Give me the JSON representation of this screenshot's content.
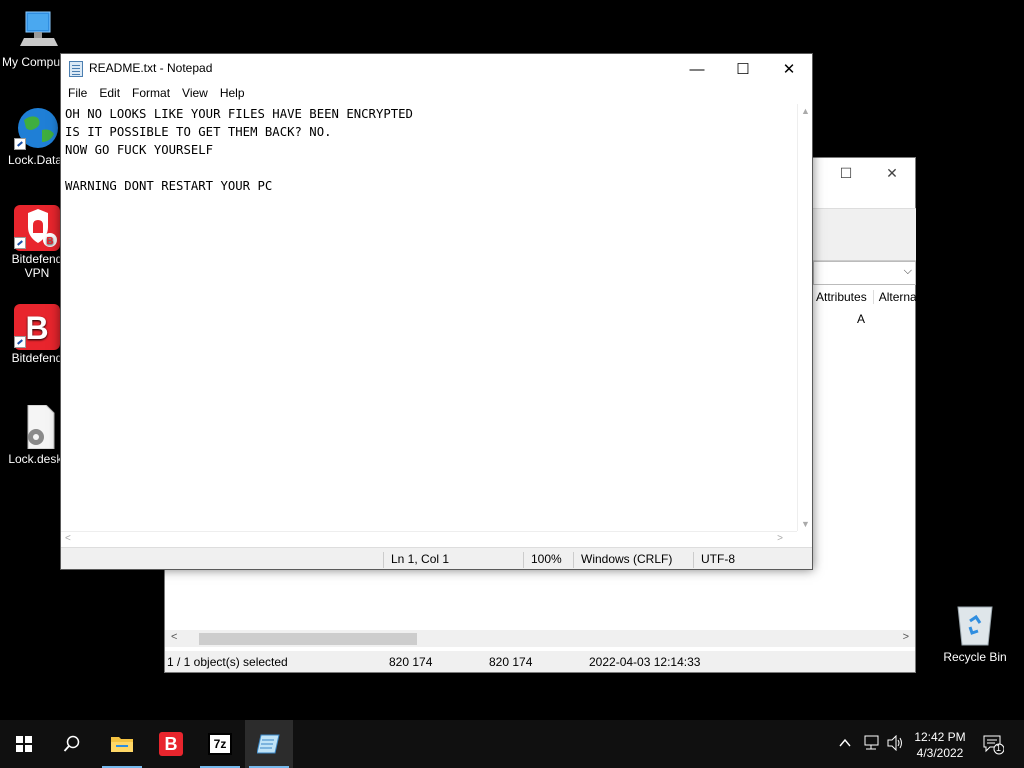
{
  "desktop": {
    "icons": [
      {
        "label": "My Compu"
      },
      {
        "label": "Lock.Data"
      },
      {
        "label": "Bitdefend\nVPN"
      },
      {
        "label": "Bitdefend"
      },
      {
        "label": "Lock.deskt"
      },
      {
        "label": "Recycle Bin"
      }
    ]
  },
  "bg_window": {
    "columns": [
      "Attributes",
      "Alterna"
    ],
    "attr_value": "A",
    "status": {
      "selected": "1 / 1 object(s) selected",
      "size": "820 174",
      "packed": "820 174",
      "modified": "2022-04-03 12:14:33"
    }
  },
  "notepad": {
    "title": "README.txt - Notepad",
    "menu": [
      "File",
      "Edit",
      "Format",
      "View",
      "Help"
    ],
    "content": "OH NO LOOKS LIKE YOUR FILES HAVE BEEN ENCRYPTED\nIS IT POSSIBLE TO GET THEM BACK? NO.\nNOW GO FUCK YOURSELF\n\nWARNING DONT RESTART YOUR PC",
    "status": {
      "position": "Ln 1, Col 1",
      "zoom": "100%",
      "line_ending": "Windows (CRLF)",
      "encoding": "UTF-8"
    }
  },
  "taskbar": {
    "bitdefender_letter": "B",
    "sevenzip_label": "7z",
    "time": "12:42 PM",
    "date": "4/3/2022",
    "notification_count": "1"
  },
  "colors": {
    "desktop_bg": "#000000",
    "taskbar_bg": "#101010",
    "bitdefender_red": "#e8252d",
    "active_indicator": "#76b9ed"
  }
}
